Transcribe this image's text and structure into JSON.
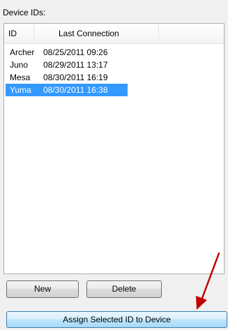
{
  "panel": {
    "label": "Device IDs:"
  },
  "list": {
    "columns": [
      "ID",
      "Last Connection",
      ""
    ],
    "rows": [
      {
        "id": "Archer",
        "last_connection": "08/25/2011 09:26",
        "selected": false
      },
      {
        "id": "Juno",
        "last_connection": "08/29/2011 13:17",
        "selected": false
      },
      {
        "id": "Mesa",
        "last_connection": "08/30/2011 16:19",
        "selected": false
      },
      {
        "id": "Yuma",
        "last_connection": "08/30/2011 16:38",
        "selected": true
      }
    ],
    "selection_color": "#3399ff"
  },
  "buttons": {
    "new_label": "New",
    "delete_label": "Delete",
    "assign_label": "Assign Selected ID to Device"
  },
  "annotation": {
    "arrow_color": "#c00000"
  }
}
